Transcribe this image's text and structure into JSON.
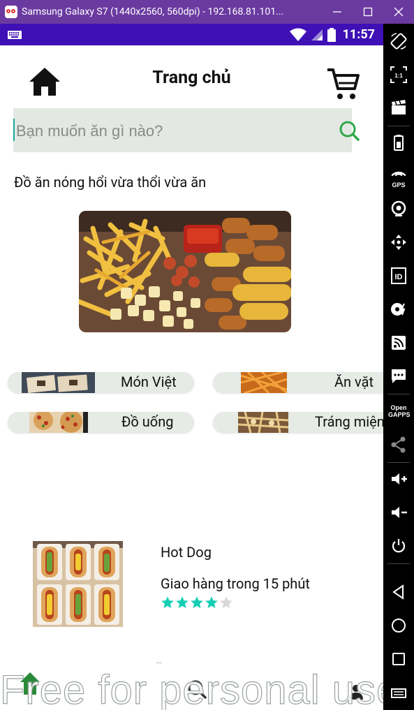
{
  "window": {
    "title": "Samsung Galaxy S7 (1440x2560, 560dpi) - 192.168.81.101..."
  },
  "status_bar": {
    "time": "11:57"
  },
  "header": {
    "title": "Trang chủ"
  },
  "search": {
    "placeholder": "Bạn muốn ăn gì nào?",
    "value": ""
  },
  "promo": {
    "text": "Đồ ăn nóng hổi vừa thổi vừa ăn"
  },
  "categories": [
    {
      "label": "Món Việt"
    },
    {
      "label": "Ăn vặt"
    },
    {
      "label": "Đồ uống"
    },
    {
      "label": "Tráng miệng"
    }
  ],
  "product": {
    "name": "Hot Dog",
    "delivery": "Giao hàng trong 15 phút",
    "rating": 4,
    "rating_max": 5
  },
  "watermark": {
    "text": "Free for personal use"
  },
  "colors": {
    "title_bar": "#6a3aa0",
    "status_bar": "#3f10b5",
    "search_bg": "#e3e8e2",
    "search_icon": "#2ea84a",
    "star_filled": "#16cfb3",
    "star_empty": "#d8d8d8",
    "category_bg": "#e6ebe6"
  },
  "icons": {
    "header_left": "home-icon",
    "header_right": "cart-icon",
    "search": "search-icon",
    "bottom_nav": [
      "home-icon",
      "search-icon",
      "user-icon"
    ]
  },
  "emulator_toolbar": {
    "open_gapps_label": "Open GAPPS",
    "gps_label": "GPS",
    "id_label": "ID",
    "scale_label": "1:1"
  }
}
